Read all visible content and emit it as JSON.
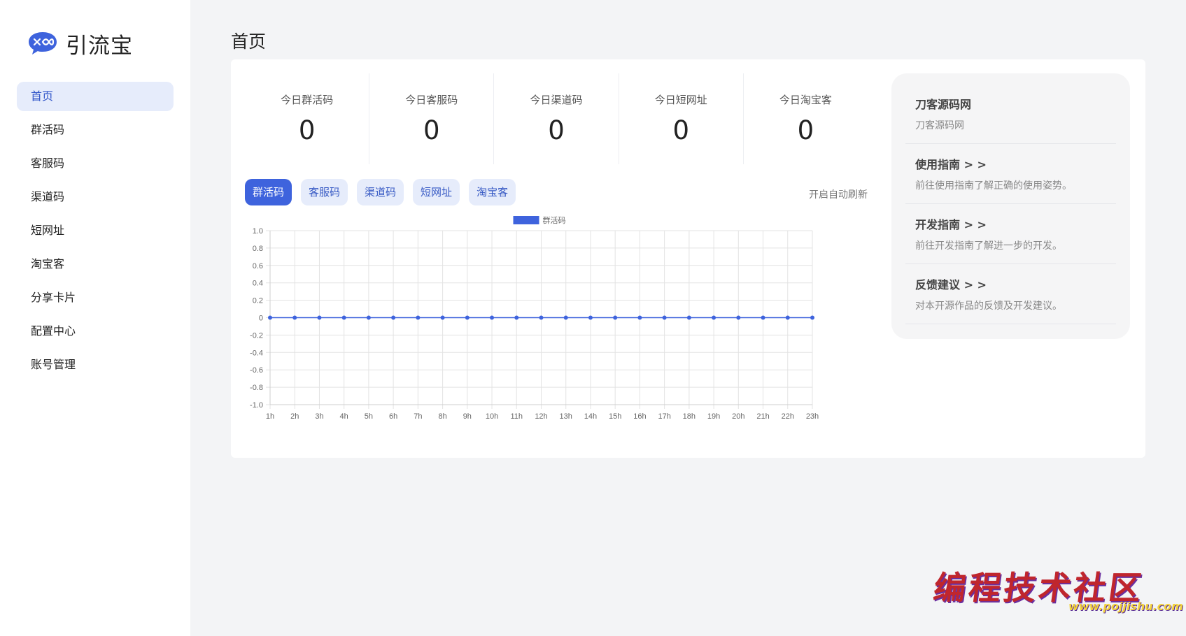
{
  "app": {
    "name": "引流宝"
  },
  "nav": {
    "items": [
      {
        "label": "首页",
        "active": true
      },
      {
        "label": "群活码",
        "active": false
      },
      {
        "label": "客服码",
        "active": false
      },
      {
        "label": "渠道码",
        "active": false
      },
      {
        "label": "短网址",
        "active": false
      },
      {
        "label": "淘宝客",
        "active": false
      },
      {
        "label": "分享卡片",
        "active": false
      },
      {
        "label": "配置中心",
        "active": false
      },
      {
        "label": "账号管理",
        "active": false
      }
    ]
  },
  "page": {
    "title": "首页"
  },
  "stats": [
    {
      "label": "今日群活码",
      "value": "0"
    },
    {
      "label": "今日客服码",
      "value": "0"
    },
    {
      "label": "今日渠道码",
      "value": "0"
    },
    {
      "label": "今日短网址",
      "value": "0"
    },
    {
      "label": "今日淘宝客",
      "value": "0"
    }
  ],
  "tabs": [
    {
      "label": "群活码",
      "active": true
    },
    {
      "label": "客服码",
      "active": false
    },
    {
      "label": "渠道码",
      "active": false
    },
    {
      "label": "短网址",
      "active": false
    },
    {
      "label": "淘宝客",
      "active": false
    }
  ],
  "refresh_label": "开启自动刷新",
  "chart_data": {
    "type": "line",
    "categories": [
      "1h",
      "2h",
      "3h",
      "4h",
      "5h",
      "6h",
      "7h",
      "8h",
      "9h",
      "10h",
      "11h",
      "12h",
      "13h",
      "14h",
      "15h",
      "16h",
      "17h",
      "18h",
      "19h",
      "20h",
      "21h",
      "22h",
      "23h"
    ],
    "series": [
      {
        "name": "群活码",
        "values": [
          0,
          0,
          0,
          0,
          0,
          0,
          0,
          0,
          0,
          0,
          0,
          0,
          0,
          0,
          0,
          0,
          0,
          0,
          0,
          0,
          0,
          0,
          0
        ]
      }
    ],
    "yticks": [
      "1.0",
      "0.8",
      "0.6",
      "0.4",
      "0.2",
      "0",
      "-0.2",
      "-0.4",
      "-0.6",
      "-0.8",
      "-1.0"
    ],
    "ylim": [
      -1,
      1
    ],
    "grid": true,
    "legend": "top-center",
    "color": "#3e63dd"
  },
  "info": [
    {
      "title": "刀客源码网",
      "desc": "刀客源码网"
    },
    {
      "title": "使用指南 > >",
      "desc": "前往使用指南了解正确的使用姿势。"
    },
    {
      "title": "开发指南 > >",
      "desc": "前往开发指南了解进一步的开发。"
    },
    {
      "title": "反馈建议 > >",
      "desc": "对本开源作品的反馈及开发建议。"
    }
  ],
  "watermark": {
    "text": "编程技术社区",
    "url": "www.pojjishu.com"
  },
  "colors": {
    "accent": "#3e63dd",
    "nav_active_bg": "#e6ecfb"
  }
}
